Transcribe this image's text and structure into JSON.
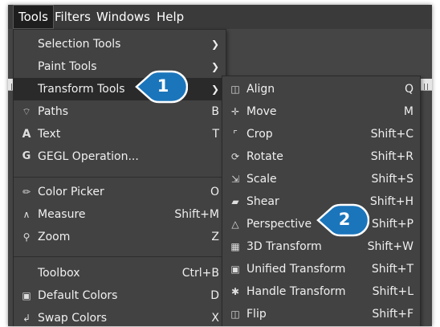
{
  "menubar": {
    "items": [
      {
        "label": "Tools"
      },
      {
        "label": "Filters"
      },
      {
        "label": "Windows"
      },
      {
        "label": "Help"
      }
    ]
  },
  "tools_menu": {
    "items": [
      {
        "label": "Selection Tools",
        "icon": "",
        "shortcut": "",
        "submenu": true
      },
      {
        "label": "Paint Tools",
        "icon": "",
        "shortcut": "",
        "submenu": true
      },
      {
        "label": "Transform Tools",
        "icon": "",
        "shortcut": "",
        "submenu": true
      },
      {
        "label": "Paths",
        "icon": "paths-icon",
        "shortcut": "B"
      },
      {
        "label": "Text",
        "icon": "text-icon",
        "shortcut": "T"
      },
      {
        "label": "GEGL Operation...",
        "icon": "gegl-icon",
        "shortcut": ""
      },
      {
        "label": "Color Picker",
        "icon": "color-picker-icon",
        "shortcut": "O"
      },
      {
        "label": "Measure",
        "icon": "measure-icon",
        "shortcut": "Shift+M"
      },
      {
        "label": "Zoom",
        "icon": "zoom-icon",
        "shortcut": "Z"
      },
      {
        "label": "Toolbox",
        "icon": "",
        "shortcut": "Ctrl+B"
      },
      {
        "label": "Default Colors",
        "icon": "default-colors-icon",
        "shortcut": "D"
      },
      {
        "label": "Swap Colors",
        "icon": "swap-colors-icon",
        "shortcut": "X"
      }
    ]
  },
  "transform_menu": {
    "items": [
      {
        "label": "Align",
        "icon": "align-icon",
        "shortcut": "Q"
      },
      {
        "label": "Move",
        "icon": "move-icon",
        "shortcut": "M"
      },
      {
        "label": "Crop",
        "icon": "crop-icon",
        "shortcut": "Shift+C"
      },
      {
        "label": "Rotate",
        "icon": "rotate-icon",
        "shortcut": "Shift+R"
      },
      {
        "label": "Scale",
        "icon": "scale-icon",
        "shortcut": "Shift+S"
      },
      {
        "label": "Shear",
        "icon": "shear-icon",
        "shortcut": "Shift+H"
      },
      {
        "label": "Perspective",
        "icon": "perspective-icon",
        "shortcut": "Shift+P"
      },
      {
        "label": "3D Transform",
        "icon": "3d-transform-icon",
        "shortcut": "Shift+W"
      },
      {
        "label": "Unified Transform",
        "icon": "unified-transform-icon",
        "shortcut": "Shift+T"
      },
      {
        "label": "Handle Transform",
        "icon": "handle-transform-icon",
        "shortcut": "Shift+L"
      },
      {
        "label": "Flip",
        "icon": "flip-icon",
        "shortcut": "Shift+F"
      }
    ]
  },
  "callouts": [
    {
      "number": "1"
    },
    {
      "number": "2"
    }
  ],
  "colors": {
    "callout": "#1b75bb",
    "menu_bg": "#424242",
    "highlight": "#2a2a2a"
  }
}
